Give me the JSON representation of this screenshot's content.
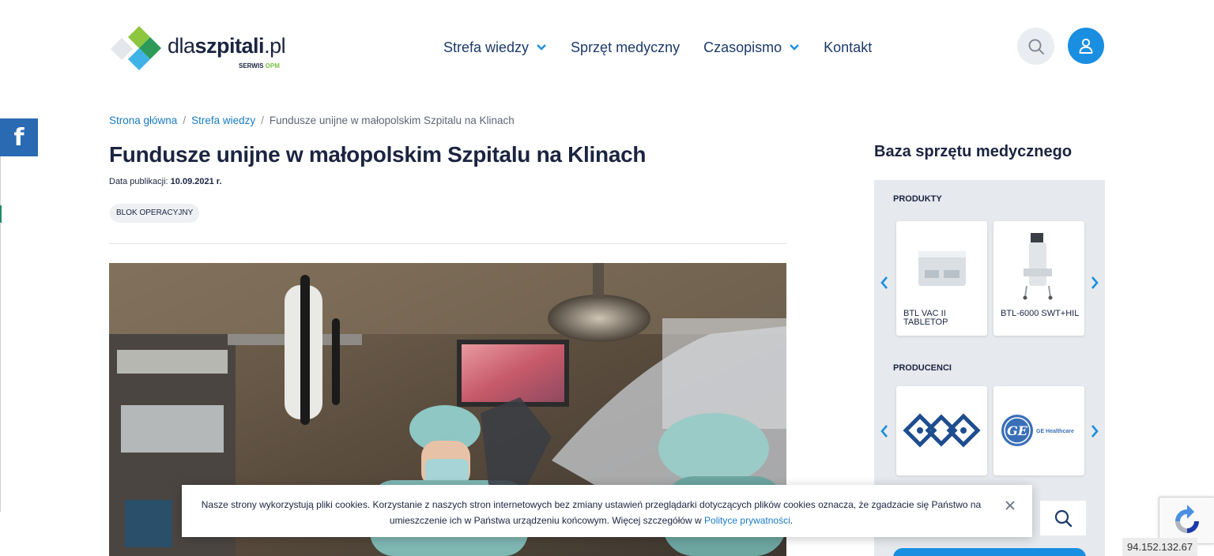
{
  "header": {
    "logo": {
      "word_dla": "dla",
      "word_szpitali": "szpitali",
      "word_pl": ".pl",
      "sub_serwis": "SERWIS",
      "sub_opm": "OPM"
    },
    "nav": [
      {
        "label": "Strefa wiedzy",
        "has_dropdown": true
      },
      {
        "label": "Sprzęt medyczny",
        "has_dropdown": false
      },
      {
        "label": "Czasopismo",
        "has_dropdown": true
      },
      {
        "label": "Kontakt",
        "has_dropdown": false
      }
    ],
    "search_icon": "search-icon",
    "user_icon": "user-icon",
    "colors": {
      "accent": "#1a8ee0",
      "nav_text": "#1b3a6b"
    }
  },
  "social": {
    "facebook_label": "f",
    "color": "#2a6ab3"
  },
  "breadcrumb": {
    "home": "Strona główna",
    "section": "Strefa wiedzy",
    "current": "Fundusze unijne w małopolskim Szpitalu na Klinach",
    "separator": "/"
  },
  "article": {
    "title": "Fundusze unijne w małopolskim Szpitalu na Klinach",
    "date_label": "Data publikacji:",
    "date_value": "10.09.2021 r.",
    "tag": "BLOK OPERACYJNY"
  },
  "sidebar": {
    "title": "Baza sprzętu medycznego",
    "products_label": "PRODUKTY",
    "products": [
      {
        "name": "BTL VAC II TABLETOP"
      },
      {
        "name": "BTL-6000 SWT+HIL"
      }
    ],
    "producers_label": "PRODUCENCI",
    "producers": [
      {
        "name": "BTL",
        "logo_icon": "btl-logo-icon"
      },
      {
        "name": "GE Healthcare",
        "logo_text": "GE Healthcare"
      }
    ]
  },
  "cookie": {
    "text": "Nasze strony wykorzystują pliki cookies. Korzystanie z naszych stron internetowych bez zmiany ustawień przeglądarki dotyczących plików cookies oznacza, że zgadzacie się Państwo na umieszczenie ich w Państwa urządzeniu końcowym. Więcej szczegółów w ",
    "link": "Polityce prywatności",
    "after_link": "."
  },
  "footer_overlay": {
    "ip": "94.152.132.67"
  }
}
